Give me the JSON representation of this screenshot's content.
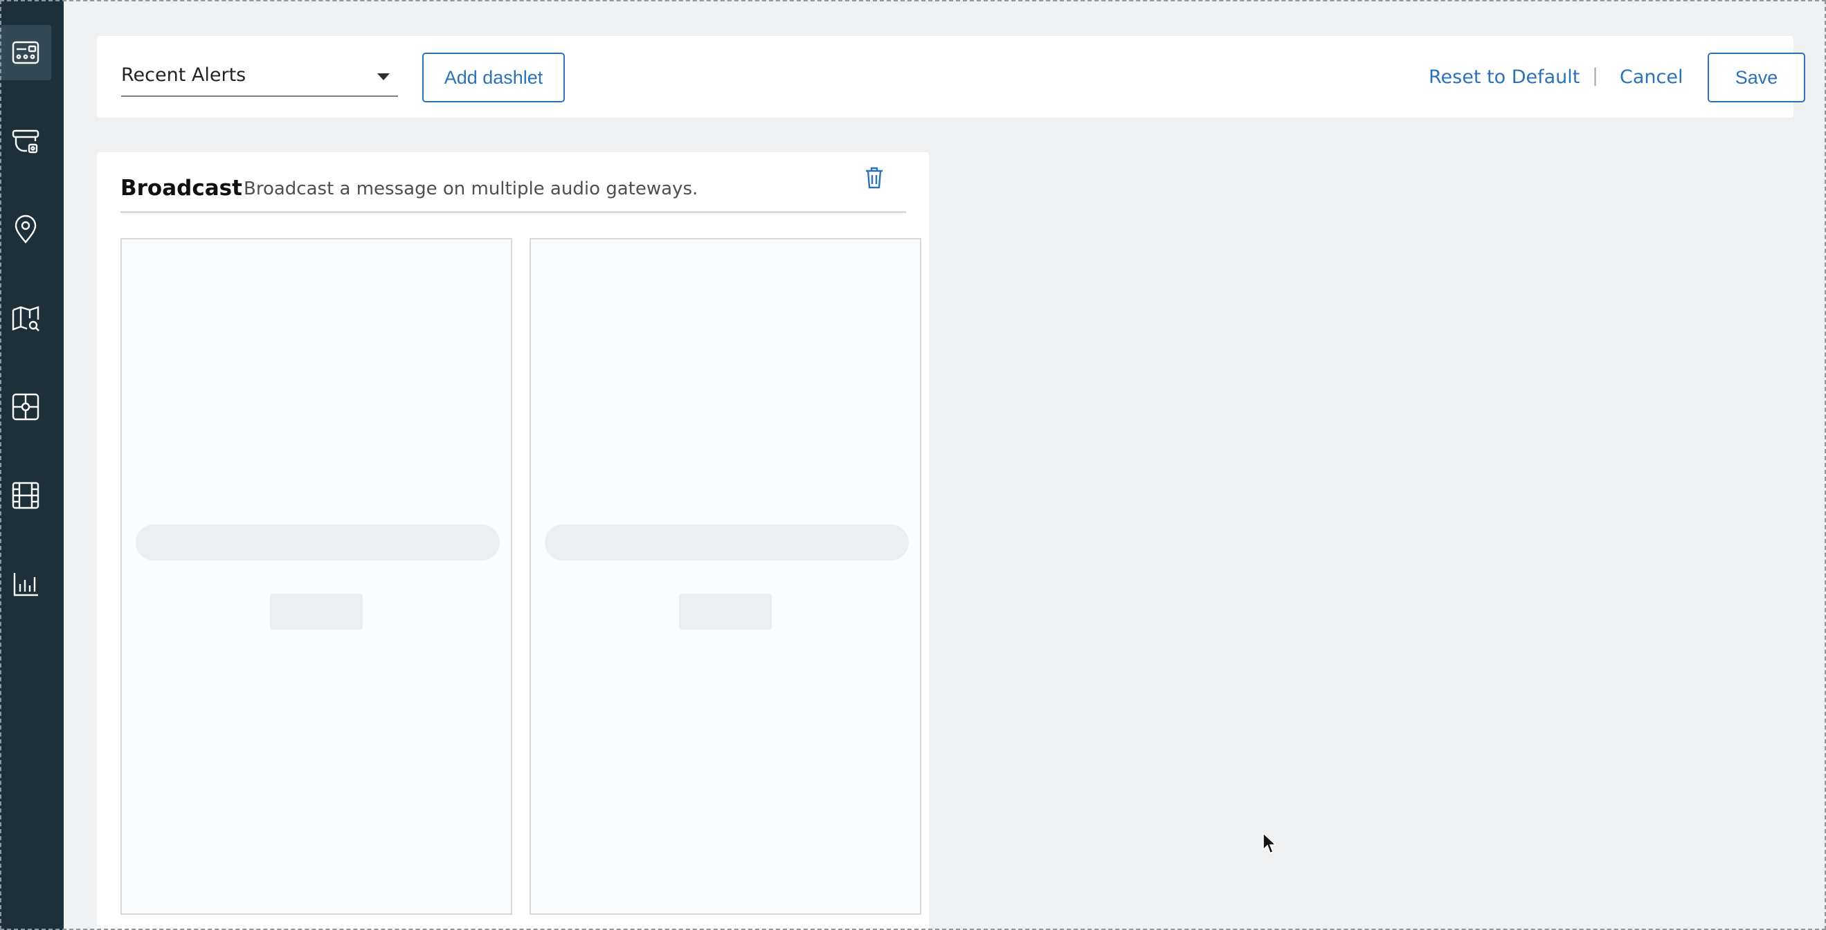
{
  "sidebar": {
    "items": [
      {
        "icon": "dashboard-icon",
        "active": true
      },
      {
        "icon": "camera-icon",
        "active": false
      },
      {
        "icon": "location-pin-icon",
        "active": false
      },
      {
        "icon": "map-search-icon",
        "active": false
      },
      {
        "icon": "tile-layout-icon",
        "active": false
      },
      {
        "icon": "film-icon",
        "active": false
      },
      {
        "icon": "bar-chart-icon",
        "active": false
      }
    ]
  },
  "toolbar": {
    "dashlet_select_value": "Recent Alerts",
    "add_dashlet_label": "Add dashlet",
    "reset_label": "Reset to Default",
    "separator": "|",
    "cancel_label": "Cancel",
    "save_label": "Save"
  },
  "dashlet": {
    "title": "Broadcast",
    "description": "Broadcast a message on multiple audio gateways.",
    "delete_icon": "trash-icon"
  },
  "colors": {
    "sidebar_bg": "#1d2f39",
    "accent": "#2b73b8",
    "page_bg": "#eff0f2"
  }
}
